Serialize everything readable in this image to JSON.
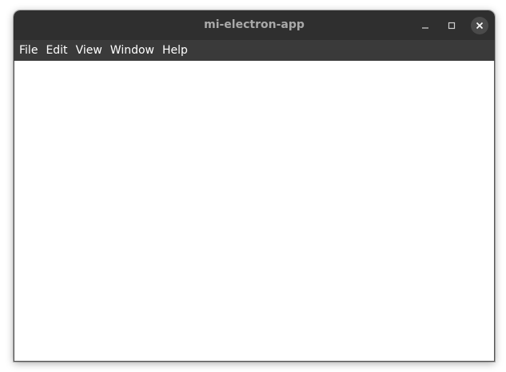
{
  "window": {
    "title": "mi-electron-app"
  },
  "controls": {
    "minimize_icon": "minimize-icon",
    "maximize_icon": "maximize-icon",
    "close_icon": "close-icon"
  },
  "menubar": {
    "items": [
      {
        "label": "File"
      },
      {
        "label": "Edit"
      },
      {
        "label": "View"
      },
      {
        "label": "Window"
      },
      {
        "label": "Help"
      }
    ]
  },
  "colors": {
    "titlebar": "#2f2f2f",
    "menubar": "#3a3a3a",
    "title_text": "#a9a9a9",
    "content": "#ffffff"
  }
}
